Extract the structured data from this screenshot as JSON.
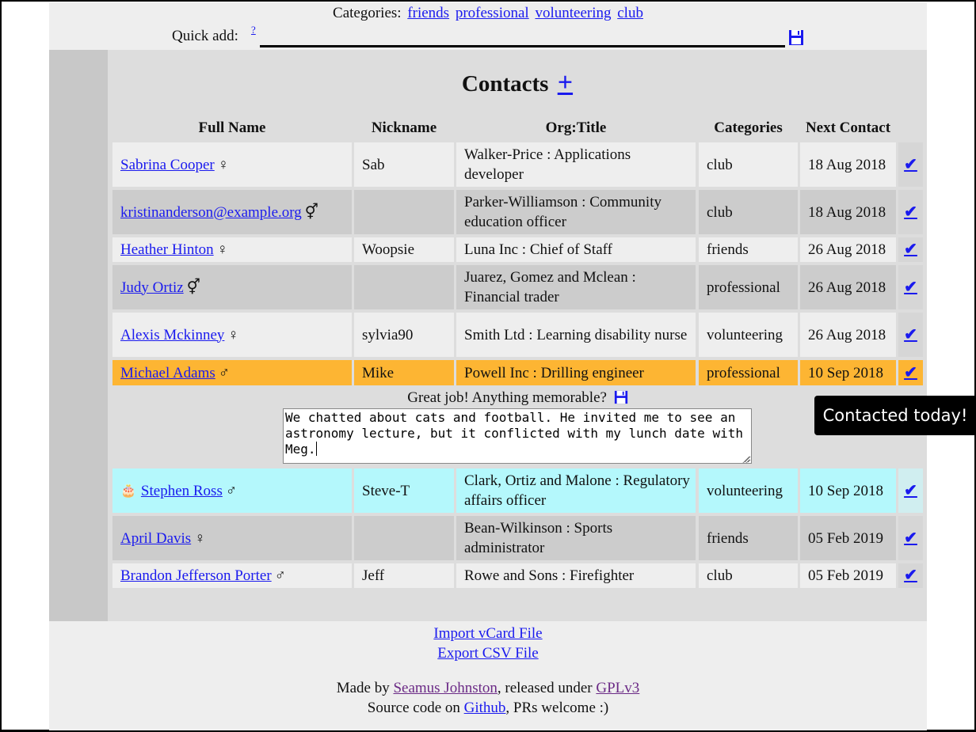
{
  "header": {
    "categories_label": "Categories:",
    "categories": [
      "friends",
      "professional",
      "volunteering",
      "club"
    ],
    "quick_add_label": "Quick add:",
    "quick_add_help": "?",
    "quick_add_value": "",
    "save_icon": "floppy-disk-icon"
  },
  "main": {
    "title": "Contacts",
    "add_symbol": "+",
    "columns": [
      "Full Name",
      "Nickname",
      "Org:Title",
      "Categories",
      "Next Contact"
    ],
    "check_symbol": "✔",
    "rows": [
      {
        "name": "Sabrina Cooper",
        "gender": "♀",
        "nickname": "Sab",
        "org": "Walker-Price : Applications developer",
        "category": "club",
        "next": "18 Aug 2018"
      },
      {
        "name": "kristinanderson@example.org",
        "gender": "⚥",
        "nickname": "",
        "org": "Parker-Williamson : Community education officer",
        "category": "club",
        "next": "18 Aug 2018"
      },
      {
        "name": "Heather Hinton",
        "gender": "♀",
        "nickname": "Woopsie",
        "org": "Luna Inc : Chief of Staff",
        "category": "friends",
        "next": "26 Aug 2018"
      },
      {
        "name": "Judy Ortiz",
        "gender": "⚥",
        "nickname": "",
        "org": "Juarez, Gomez and Mclean : Financial trader",
        "category": "professional",
        "next": "26 Aug 2018"
      },
      {
        "name": "Alexis Mckinney",
        "gender": "♀",
        "nickname": "sylvia90",
        "org": "Smith Ltd : Learning disability nurse",
        "category": "volunteering",
        "next": "26 Aug 2018"
      },
      {
        "name": "Michael Adams",
        "gender": "♂",
        "nickname": "Mike",
        "org": "Powell Inc : Drilling engineer",
        "category": "professional",
        "next": "10 Sep 2018"
      },
      {
        "name": "Stephen Ross",
        "gender": "♂",
        "birthday_icon": "🎂",
        "nickname": "Steve-T",
        "org": "Clark, Ortiz and Malone : Regulatory affairs officer",
        "category": "volunteering",
        "next": "10 Sep 2018"
      },
      {
        "name": "April Davis",
        "gender": "♀",
        "nickname": "",
        "org": "Bean-Wilkinson : Sports administrator",
        "category": "friends",
        "next": "05 Feb 2019"
      },
      {
        "name": "Brandon Jefferson Porter",
        "gender": "♂",
        "nickname": "Jeff",
        "org": "Rowe and Sons : Firefighter",
        "category": "club",
        "next": "05 Feb 2019"
      }
    ],
    "memo_prompt": "Great job! Anything memorable?",
    "memo_text": "We chatted about cats and football. He invited me to see an astronomy lecture, but it conflicted with my lunch date with Meg."
  },
  "footer": {
    "import_link": "Import vCard File",
    "export_link": "Export CSV File",
    "made_by_prefix": "Made by",
    "author": "Seamus Johnston",
    "released_under": ", released under",
    "license": "GPLv3",
    "source_prefix": "Source code on",
    "github": "Github",
    "source_suffix": ", PRs welcome :)"
  },
  "toast": {
    "message": "Contacted today!",
    "background": "#000000"
  },
  "colors": {
    "highlight_row": "#fdb533",
    "birthday_row": "#b4f8fc",
    "link": "#1a1aee",
    "visited_link": "#6b2a86"
  }
}
